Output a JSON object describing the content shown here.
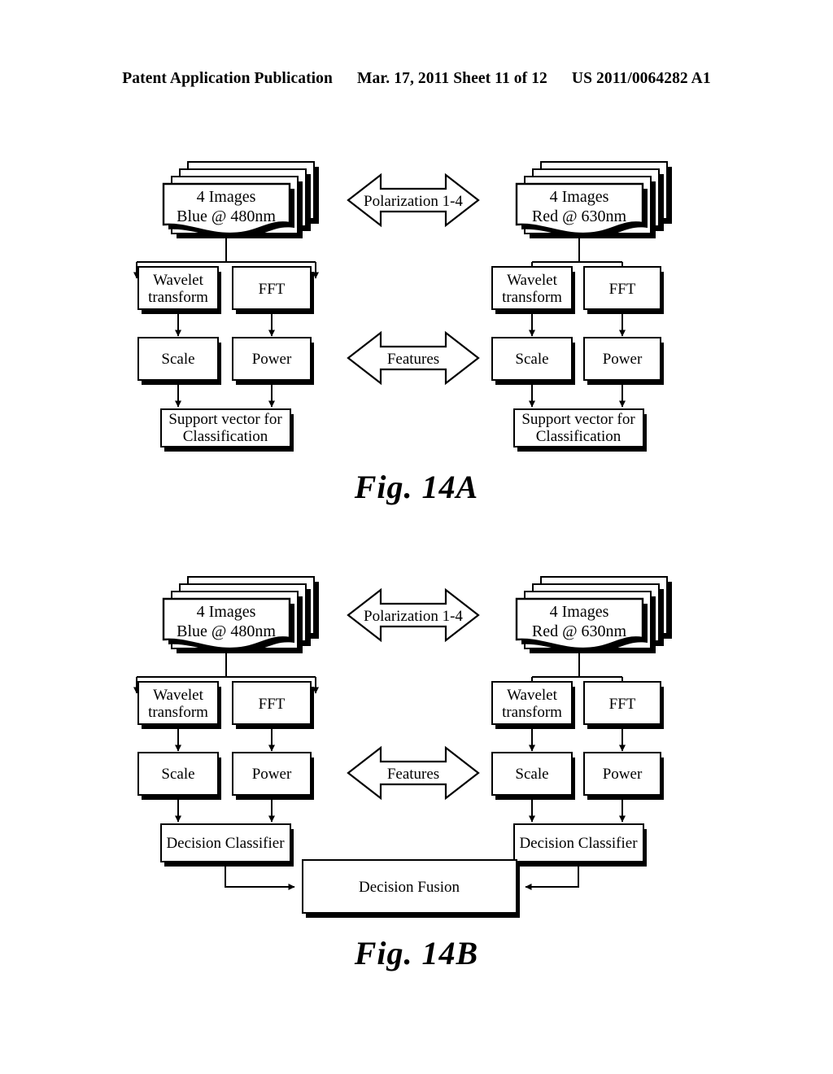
{
  "header": {
    "left": "Patent Application Publication",
    "middle": "Mar. 17, 2011  Sheet 11 of 12",
    "right": "US 2011/0064282 A1"
  },
  "colors": {
    "ink": "#000000",
    "paper": "#ffffff",
    "shadow": "#000000"
  },
  "figures": [
    {
      "id": "fig-14a",
      "caption": "Fig. 14A",
      "left_branch": {
        "source_stack": {
          "line1": "4 Images",
          "line2": "Blue @ 480nm",
          "sheet_count": 4
        },
        "nodes": [
          {
            "id": "wavelet",
            "label": "Wavelet transform"
          },
          {
            "id": "fft",
            "label": "FFT"
          },
          {
            "id": "scale",
            "label": "Scale"
          },
          {
            "id": "power",
            "label": "Power"
          },
          {
            "id": "output",
            "label": "Support vector for Classification"
          }
        ]
      },
      "right_branch": {
        "source_stack": {
          "line1": "4 Images",
          "line2": "Red @ 630nm",
          "sheet_count": 4
        },
        "nodes": [
          {
            "id": "wavelet",
            "label": "Wavelet transform"
          },
          {
            "id": "fft",
            "label": "FFT"
          },
          {
            "id": "scale",
            "label": "Scale"
          },
          {
            "id": "power",
            "label": "Power"
          },
          {
            "id": "output",
            "label": "Support vector for Classification"
          }
        ]
      },
      "center_arrows": [
        {
          "id": "polarization",
          "label": "Polarization 1-4"
        },
        {
          "id": "features",
          "label": "Features"
        }
      ]
    },
    {
      "id": "fig-14b",
      "caption": "Fig. 14B",
      "left_branch": {
        "source_stack": {
          "line1": "4 Images",
          "line2": "Blue @ 480nm",
          "sheet_count": 4
        },
        "nodes": [
          {
            "id": "wavelet",
            "label": "Wavelet transform"
          },
          {
            "id": "fft",
            "label": "FFT"
          },
          {
            "id": "scale",
            "label": "Scale"
          },
          {
            "id": "power",
            "label": "Power"
          },
          {
            "id": "output",
            "label": "Decision Classifier"
          }
        ]
      },
      "right_branch": {
        "source_stack": {
          "line1": "4 Images",
          "line2": "Red @ 630nm",
          "sheet_count": 4
        },
        "nodes": [
          {
            "id": "wavelet",
            "label": "Wavelet transform"
          },
          {
            "id": "fft",
            "label": "FFT"
          },
          {
            "id": "scale",
            "label": "Scale"
          },
          {
            "id": "power",
            "label": "Power"
          },
          {
            "id": "output",
            "label": "Decision Classifier"
          }
        ]
      },
      "center_arrows": [
        {
          "id": "polarization",
          "label": "Polarization 1-4"
        },
        {
          "id": "features",
          "label": "Features"
        }
      ],
      "fusion": {
        "id": "decision-fusion",
        "label": "Decision Fusion"
      }
    }
  ],
  "labels": {
    "wavelet_line1": "Wavelet",
    "wavelet_line2": "transform",
    "fft": "FFT",
    "scale": "Scale",
    "power": "Power",
    "support_vector_line1": "Support vector for",
    "support_vector_line2": "Classification",
    "decision_classifier": "Decision Classifier",
    "decision_fusion": "Decision Fusion",
    "polarization": "Polarization 1-4",
    "features": "Features",
    "images_line1": "4 Images",
    "blue_line2": "Blue @ 480nm",
    "red_line2": "Red @ 630nm"
  }
}
